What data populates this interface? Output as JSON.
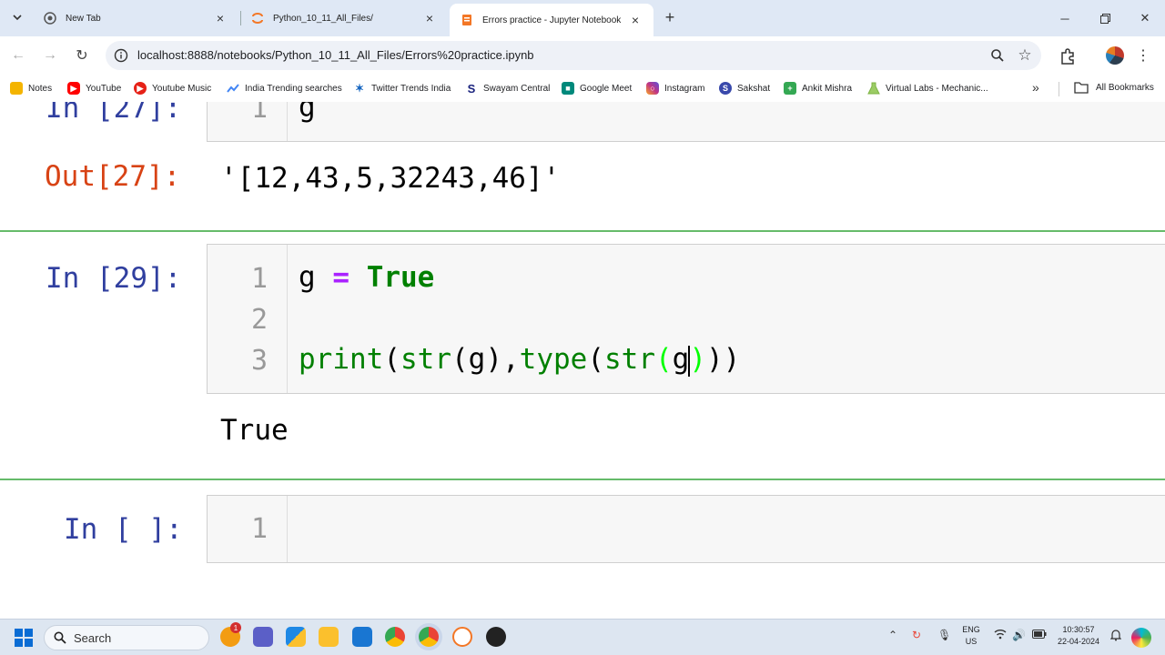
{
  "browser": {
    "tabs": [
      {
        "title": "New Tab",
        "active": false
      },
      {
        "title": "Python_10_11_All_Files/",
        "active": false
      },
      {
        "title": "Errors practice - Jupyter Notebook",
        "active": true
      }
    ],
    "url": "localhost:8888/notebooks/Python_10_11_All_Files/Errors%20practice.ipynb",
    "bookmarks": [
      {
        "label": "Notes",
        "color": "#f4b400"
      },
      {
        "label": "YouTube",
        "color": "#ff0000"
      },
      {
        "label": "Youtube Music",
        "color": "#e62117"
      },
      {
        "label": "India Trending searches",
        "color": "#4285f4"
      },
      {
        "label": "Twitter Trends India",
        "color": "#1565c0"
      },
      {
        "label": "Swayam Central",
        "color": "#1a237e"
      },
      {
        "label": "Google Meet",
        "color": "#00897b"
      },
      {
        "label": "Instagram",
        "color": "#c13584"
      },
      {
        "label": "Sakshat",
        "color": "#3949ab"
      },
      {
        "label": "Ankit Mishra",
        "color": "#34a853"
      },
      {
        "label": "Virtual Labs - Mechanic...",
        "color": "#7cb342"
      }
    ],
    "all_bookmarks_label": "All Bookmarks"
  },
  "notebook": {
    "cell27": {
      "prompt": "In [27]:",
      "line_number": "1",
      "code": "g"
    },
    "out27": {
      "prompt": "Out[27]:",
      "text": "'[12,43,5,32243,46]'"
    },
    "cell29": {
      "prompt": "In [29]:",
      "line_numbers": [
        "1",
        "2",
        "3"
      ],
      "line1": {
        "var": "g",
        "op": "=",
        "kw": "True"
      },
      "line3": {
        "print": "print",
        "str1": "str",
        "arg1": "g",
        "type": "type",
        "str2": "str",
        "arg2": "g"
      }
    },
    "out29": {
      "text": "True"
    },
    "cell_empty": {
      "prompt": "In [ ]:",
      "line_number": "1"
    }
  },
  "taskbar": {
    "search_placeholder": "Search",
    "language": [
      "ENG",
      "US"
    ],
    "time": "10:30:57",
    "date": "22-04-2024",
    "badge": "1"
  }
}
